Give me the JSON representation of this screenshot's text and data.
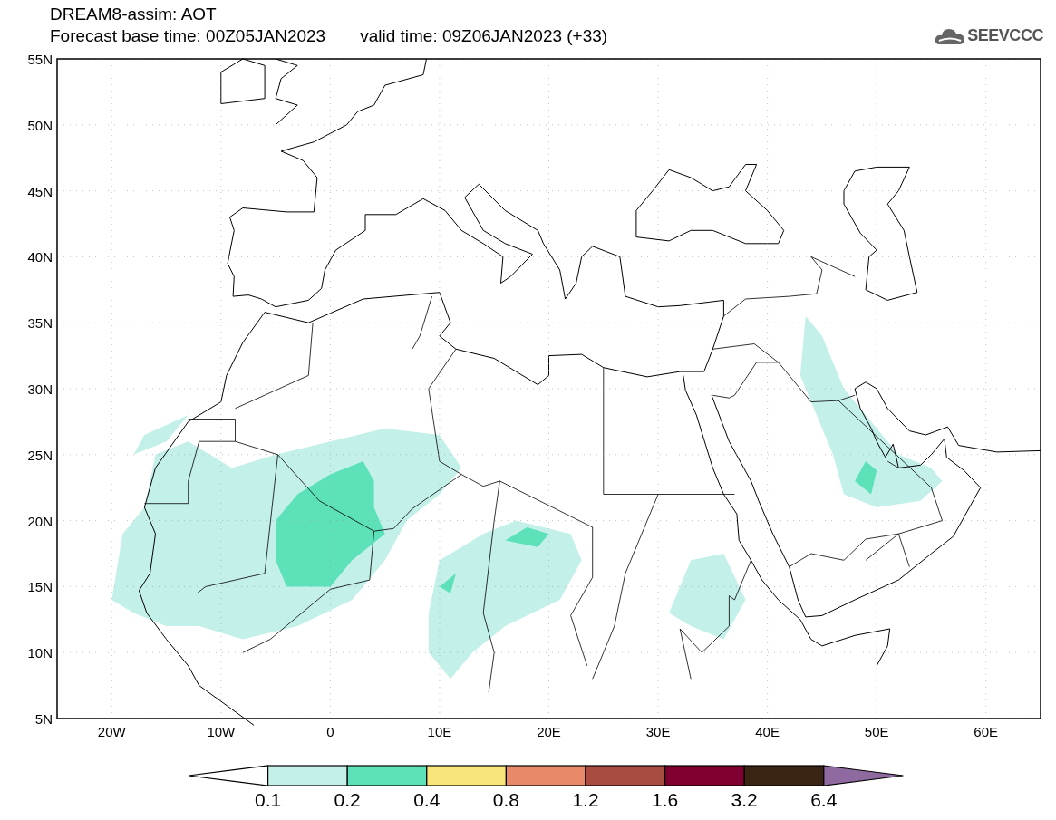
{
  "title": "DREAM8-assim: AOT",
  "base_time": "Forecast base time: 00Z05JAN2023",
  "valid_time": "valid time: 09Z06JAN2023 (+33)",
  "logo": {
    "text": "SEEVCCC"
  },
  "map": {
    "lat_labels": [
      "55N",
      "50N",
      "45N",
      "40N",
      "35N",
      "30N",
      "25N",
      "20N",
      "15N",
      "10N",
      "5N"
    ],
    "lon_labels": [
      "20W",
      "10W",
      "0",
      "10E",
      "20E",
      "30E",
      "40E",
      "50E",
      "60E"
    ]
  },
  "colorbar": {
    "segments": [
      {
        "kind": "lower-arrow",
        "color": "#ffffff"
      },
      {
        "kind": "box",
        "color": "#c4f0ea"
      },
      {
        "kind": "box",
        "color": "#5ce1b9"
      },
      {
        "kind": "box",
        "color": "#f8e67a"
      },
      {
        "kind": "box",
        "color": "#e88a6a"
      },
      {
        "kind": "box",
        "color": "#a84c42"
      },
      {
        "kind": "box",
        "color": "#7f0030"
      },
      {
        "kind": "box",
        "color": "#3b2414"
      },
      {
        "kind": "upper-arrow",
        "color": "#8e6aa0"
      }
    ],
    "labels": [
      "0.1",
      "0.2",
      "0.4",
      "0.8",
      "1.2",
      "1.6",
      "3.2",
      "6.4"
    ]
  }
}
